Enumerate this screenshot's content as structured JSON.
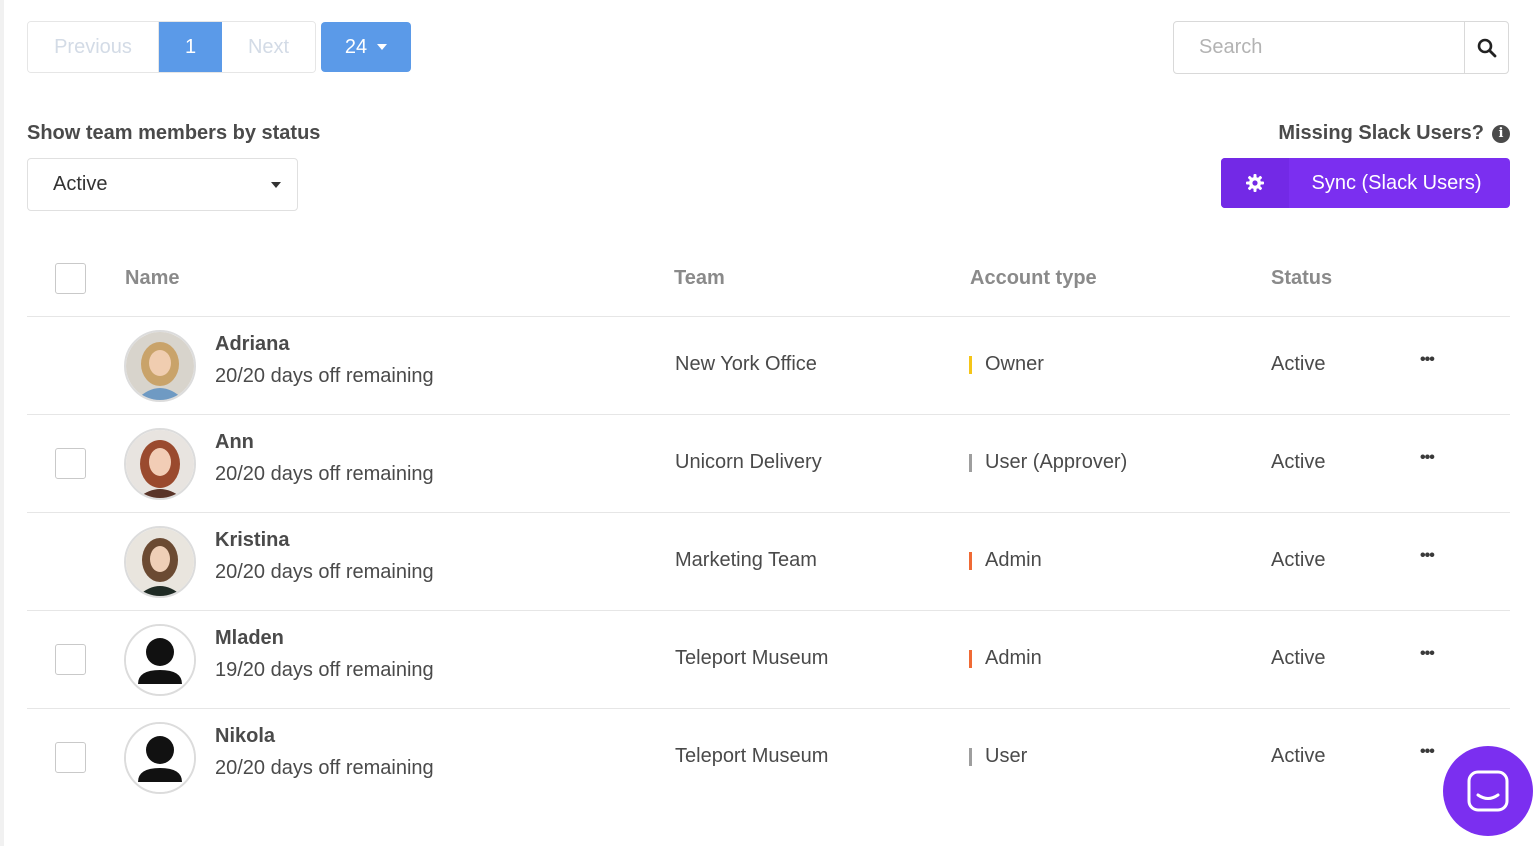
{
  "pagination": {
    "previous_label": "Previous",
    "current_page": "1",
    "next_label": "Next",
    "per_page": "24"
  },
  "search": {
    "placeholder": "Search",
    "icon": "search-icon"
  },
  "filter": {
    "label": "Show team members by status",
    "selected": "Active"
  },
  "slack": {
    "missing_label": "Missing Slack Users?",
    "info_icon": "info-icon",
    "sync_label": "Sync (Slack Users)",
    "sync_icon": "gear-icon"
  },
  "table": {
    "headers": {
      "name": "Name",
      "team": "Team",
      "account_type": "Account type",
      "status": "Status"
    },
    "rows": [
      {
        "name": "Adriana",
        "days_off": "20/20 days off remaining",
        "team": "New York Office",
        "account_type": "Owner",
        "account_color": "#f5c518",
        "status": "Active",
        "more": "•••"
      },
      {
        "name": "Ann",
        "days_off": "20/20 days off remaining",
        "team": "Unicorn Delivery",
        "account_type": "User (Approver)",
        "account_color": "#9e9e9e",
        "status": "Active",
        "more": "•••"
      },
      {
        "name": "Kristina",
        "days_off": "20/20 days off remaining",
        "team": "Marketing Team",
        "account_type": "Admin",
        "account_color": "#f06a35",
        "status": "Active",
        "more": "•••"
      },
      {
        "name": "Mladen",
        "days_off": "19/20 days off remaining",
        "team": "Teleport Museum",
        "account_type": "Admin",
        "account_color": "#f06a35",
        "status": "Active",
        "more": "•••"
      },
      {
        "name": "Nikola",
        "days_off": "20/20 days off remaining",
        "team": "Teleport Museum",
        "account_type": "User",
        "account_color": "#9e9e9e",
        "status": "Active",
        "more": "•••"
      }
    ]
  },
  "colors": {
    "primary": "#5b9ae8",
    "slack_purple": "#7b2ff0"
  }
}
